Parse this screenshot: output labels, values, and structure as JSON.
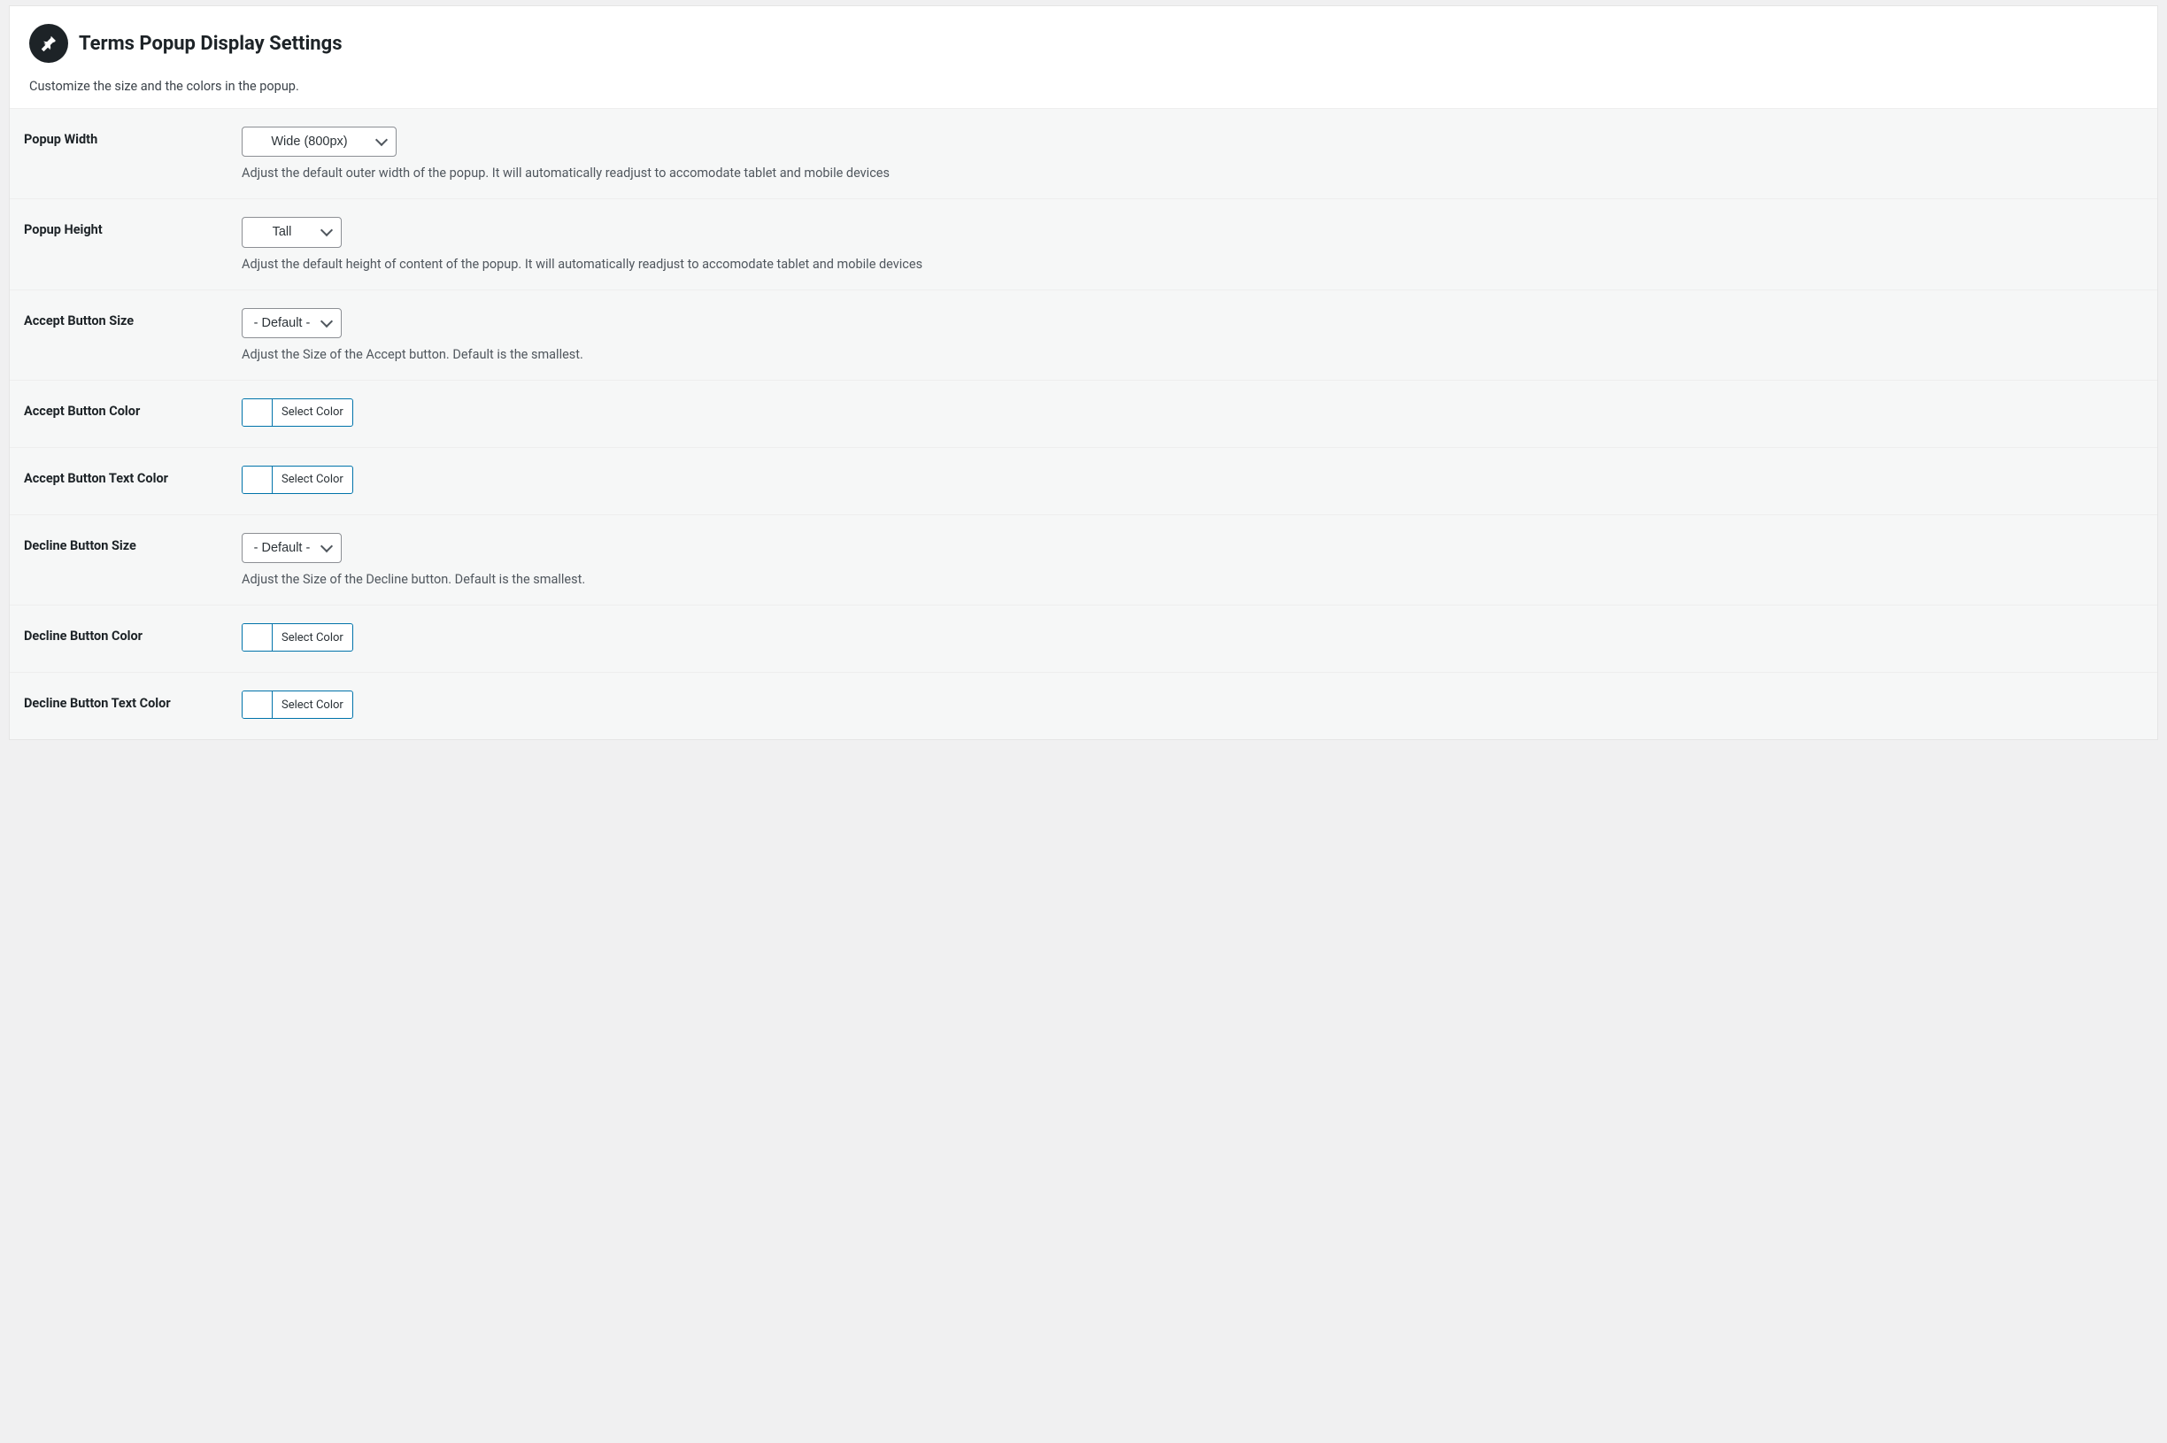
{
  "header": {
    "title": "Terms Popup Display Settings",
    "subtitle": "Customize the size and the colors in the popup."
  },
  "rows": {
    "popupWidth": {
      "label": "Popup Width",
      "value": "Wide (800px)",
      "help": "Adjust the default outer width of the popup. It will automatically readjust to accomodate tablet and mobile devices"
    },
    "popupHeight": {
      "label": "Popup Height",
      "value": "Tall",
      "help": "Adjust the default height of content of the popup. It will automatically readjust to accomodate tablet and mobile devices"
    },
    "acceptSize": {
      "label": "Accept Button Size",
      "value": "- Default -",
      "help": "Adjust the Size of the Accept button. Default is the smallest."
    },
    "acceptColor": {
      "label": "Accept Button Color",
      "button": "Select Color"
    },
    "acceptTextColor": {
      "label": "Accept Button Text Color",
      "button": "Select Color"
    },
    "declineSize": {
      "label": "Decline Button Size",
      "value": "- Default -",
      "help": "Adjust the Size of the Decline button. Default is the smallest."
    },
    "declineColor": {
      "label": "Decline Button Color",
      "button": "Select Color"
    },
    "declineTextColor": {
      "label": "Decline Button Text Color",
      "button": "Select Color"
    }
  }
}
